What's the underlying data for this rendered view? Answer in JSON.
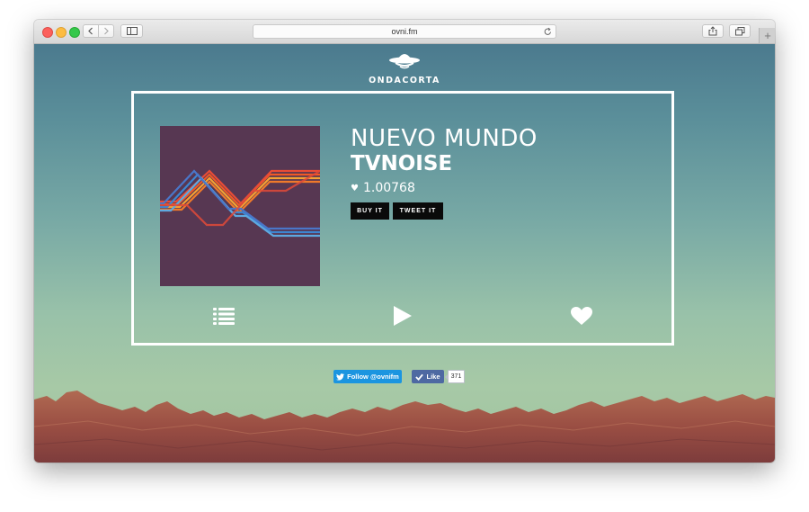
{
  "browser": {
    "url": "ovni.fm"
  },
  "brand": {
    "name": "ONDACORTA"
  },
  "track": {
    "title": "NUEVO MUNDO",
    "artist": "TVNOISE",
    "frequency": "1.00768",
    "frequency_icon": "heart-icon"
  },
  "actions": {
    "buy_label": "BUY IT",
    "tweet_label": "TWEET IT"
  },
  "controls": {
    "playlist_icon": "list-icon",
    "play_icon": "play-icon",
    "favorite_icon": "heart-icon"
  },
  "social": {
    "twitter_label": "Follow @ovnifm",
    "facebook_label": "Like",
    "facebook_count": "371"
  },
  "colors": {
    "cover_bg": "#573752",
    "button_bg": "#0a0a0a",
    "twitter_blue": "#1b95e0",
    "facebook_blue": "#4e69a2",
    "frame": "#ffffff"
  }
}
